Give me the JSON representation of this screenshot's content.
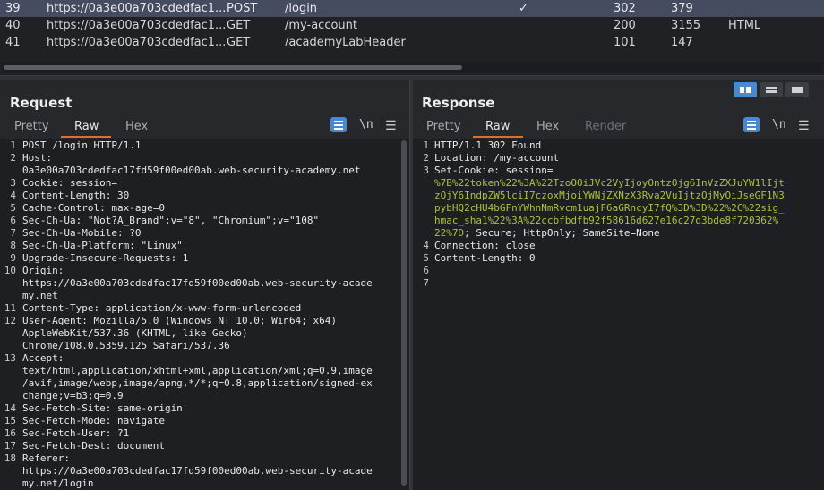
{
  "history": {
    "rows": [
      {
        "id": "39",
        "host": "https://0a3e00a703cdedfac1...",
        "method": "POST",
        "url": "/login",
        "check": "✓",
        "status": "302",
        "length": "379",
        "mime": ""
      },
      {
        "id": "40",
        "host": "https://0a3e00a703cdedfac1...",
        "method": "GET",
        "url": "/my-account",
        "check": "",
        "status": "200",
        "length": "3155",
        "mime": "HTML"
      },
      {
        "id": "41",
        "host": "https://0a3e00a703cdedfac1...",
        "method": "GET",
        "url": "/academyLabHeader",
        "check": "",
        "status": "101",
        "length": "147",
        "mime": ""
      }
    ]
  },
  "request": {
    "title": "Request",
    "tabs": [
      "Pretty",
      "Raw",
      "Hex"
    ],
    "newline_label": "\\n",
    "lines": [
      {
        "n": "1",
        "t": "POST /login HTTP/1.1"
      },
      {
        "n": "2",
        "t": "Host:"
      },
      {
        "n": "",
        "t": "0a3e00a703cdedfac17fd59f00ed00ab.web-security-academy.net"
      },
      {
        "n": "3",
        "t": "Cookie: session="
      },
      {
        "n": "4",
        "t": "Content-Length: 30"
      },
      {
        "n": "5",
        "t": "Cache-Control: max-age=0"
      },
      {
        "n": "6",
        "t": "Sec-Ch-Ua: \"Not?A_Brand\";v=\"8\", \"Chromium\";v=\"108\""
      },
      {
        "n": "7",
        "t": "Sec-Ch-Ua-Mobile: ?0"
      },
      {
        "n": "8",
        "t": "Sec-Ch-Ua-Platform: \"Linux\""
      },
      {
        "n": "9",
        "t": "Upgrade-Insecure-Requests: 1"
      },
      {
        "n": "10",
        "t": "Origin:"
      },
      {
        "n": "",
        "t": "https://0a3e00a703cdedfac17fd59f00ed00ab.web-security-acade"
      },
      {
        "n": "",
        "t": "my.net"
      },
      {
        "n": "11",
        "t": "Content-Type: application/x-www-form-urlencoded"
      },
      {
        "n": "12",
        "t": "User-Agent: Mozilla/5.0 (Windows NT 10.0; Win64; x64)"
      },
      {
        "n": "",
        "t": "AppleWebKit/537.36 (KHTML, like Gecko)"
      },
      {
        "n": "",
        "t": "Chrome/108.0.5359.125 Safari/537.36"
      },
      {
        "n": "13",
        "t": "Accept:"
      },
      {
        "n": "",
        "t": "text/html,application/xhtml+xml,application/xml;q=0.9,image"
      },
      {
        "n": "",
        "t": "/avif,image/webp,image/apng,*/*;q=0.8,application/signed-ex"
      },
      {
        "n": "",
        "t": "change;v=b3;q=0.9"
      },
      {
        "n": "14",
        "t": "Sec-Fetch-Site: same-origin"
      },
      {
        "n": "15",
        "t": "Sec-Fetch-Mode: navigate"
      },
      {
        "n": "16",
        "t": "Sec-Fetch-User: ?1"
      },
      {
        "n": "17",
        "t": "Sec-Fetch-Dest: document"
      },
      {
        "n": "18",
        "t": "Referer:"
      },
      {
        "n": "",
        "t": "https://0a3e00a703cdedfac17fd59f00ed00ab.web-security-acade"
      },
      {
        "n": "",
        "t": "my.net/login"
      }
    ]
  },
  "response": {
    "title": "Response",
    "tabs": [
      "Pretty",
      "Raw",
      "Hex",
      "Render"
    ],
    "newline_label": "\\n",
    "lines": [
      {
        "n": "1",
        "t": "HTTP/1.1 302 Found",
        "enc": false
      },
      {
        "n": "2",
        "t": "Location: /my-account",
        "enc": false
      },
      {
        "n": "3",
        "t": "Set-Cookie: session=",
        "enc": false
      },
      {
        "n": "",
        "t": "%7B%22token%22%3A%22TzoOOiJVc2VyIjoyOntzOjg6InVzZXJuYW1lIjt",
        "enc": true
      },
      {
        "n": "",
        "t": "zOjY6IndpZW5lciI7czoxMjoiYWNjZXNzX3Rva2VuIjtzOjMyOiJseGF1N3",
        "enc": true
      },
      {
        "n": "",
        "t": "pybHQ2cHU4bGFnYWhnNmRvcm1uajF6aGRncyI7fQ%3D%3D%22%2C%22sig_",
        "enc": true
      },
      {
        "n": "",
        "t": "hmac_sha1%22%3A%22ccbfbdfb92f58616d627e16c27d3bde8f720362%",
        "enc": true
      },
      {
        "n": "",
        "t": "22%7D",
        "enc": true,
        "suffix": "; Secure; HttpOnly; SameSite=None"
      },
      {
        "n": "4",
        "t": "Connection: close",
        "enc": false
      },
      {
        "n": "5",
        "t": "Content-Length: 0",
        "enc": false
      },
      {
        "n": "6",
        "t": "",
        "enc": false
      },
      {
        "n": "7",
        "t": "",
        "enc": false
      }
    ]
  },
  "colors": {
    "accent": "#e06c2f",
    "button_blue": "#4a88d0",
    "selected_row": "#454c60",
    "encoded_text": "#a6c43c"
  }
}
